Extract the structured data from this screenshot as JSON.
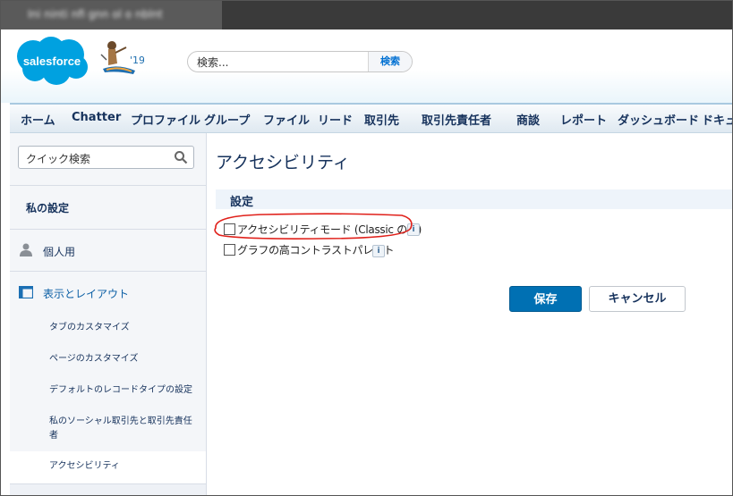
{
  "browser": {
    "tab_title": "Ini ninti nfi gnn ol o nblnt"
  },
  "header": {
    "logo_text": "salesforce",
    "release_badge": "'19",
    "search": {
      "value": "検索...",
      "button_label": "検索"
    }
  },
  "nav": {
    "items": [
      "ホーム",
      "Chatter",
      "プロファイル",
      "グループ",
      "ファイル",
      "リード",
      "取引先",
      "取引先責任者",
      "商談",
      "レポート",
      "ダッシュボード",
      "ドキュ"
    ]
  },
  "sidebar": {
    "quick_search_placeholder": "クイック検索",
    "my_settings": "私の設定",
    "personal": "個人用",
    "display_layout": "表示とレイアウト",
    "sub_items": [
      "タブのカスタマイズ",
      "ページのカスタマイズ",
      "デフォルトのレコードタイプの設定",
      "私のソーシャル取引先と取引先責任者",
      "アクセシビリティ"
    ]
  },
  "main": {
    "title": "アクセシビリティ",
    "settings_header": "設定",
    "options": [
      {
        "label": "アクセシビリティモード (Classic のみ)",
        "checked": false,
        "info": "i"
      },
      {
        "label": "グラフの高コントラストパレット",
        "checked": false,
        "info": "i"
      }
    ],
    "save_label": "保存",
    "cancel_label": "キャンセル"
  },
  "colors": {
    "brand": "#00a1e0",
    "primary_button": "#0070b3",
    "annotation": "#e0201a"
  }
}
